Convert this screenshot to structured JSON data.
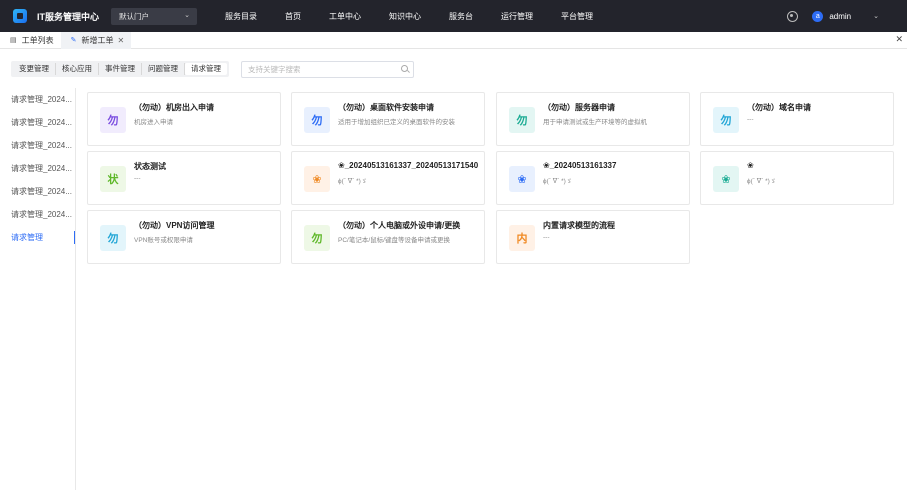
{
  "header": {
    "app_title": "IT服务管理中心",
    "portal": "默认门户",
    "nav": [
      "服务目录",
      "首页",
      "工单中心",
      "知识中心",
      "服务台",
      "运行管理",
      "平台管理"
    ],
    "user": {
      "avatar_letter": "a",
      "name": "admin"
    }
  },
  "tabs": [
    {
      "label": "工单列表"
    },
    {
      "label": "新增工单",
      "close": "✕"
    }
  ],
  "filter": {
    "categories": [
      "变更管理",
      "核心应用",
      "事件管理",
      "问题管理",
      "请求管理"
    ],
    "active": "请求管理",
    "search_placeholder": "支持关键字搜索"
  },
  "sidebar": {
    "items": [
      "请求管理_2024...",
      "请求管理_2024...",
      "请求管理_2024...",
      "请求管理_2024...",
      "请求管理_2024...",
      "请求管理_2024...",
      "请求管理"
    ],
    "active_index": 6
  },
  "cards": [
    {
      "icon": "勿",
      "title": "（勿动）机房出入申请",
      "desc": "机房进入申请",
      "bg": "#f1ecfd",
      "fg": "#7a4ce0"
    },
    {
      "icon": "勿",
      "title": "（勿动）桌面软件安装申请",
      "desc": "适用于增加组织已定义的桌面软件的安装",
      "bg": "#e8f0fe",
      "fg": "#2d6cf5"
    },
    {
      "icon": "勿",
      "title": "（勿动）服务器申请",
      "desc": "用于申请测试或生产环境等的虚拟机",
      "bg": "#e3f6f3",
      "fg": "#1aab93"
    },
    {
      "icon": "勿",
      "title": "（勿动）域名申请",
      "desc": "---",
      "bg": "#e3f5fb",
      "fg": "#22a6d6"
    },
    {
      "icon": "状",
      "title": "状态测试",
      "desc": "---",
      "bg": "#eef8e6",
      "fg": "#5fb82a"
    },
    {
      "icon": "❀",
      "title": "❀_20240513161337_20240513171540",
      "desc": "ɸ(ˊ ᐁˋ *)ゞ",
      "bg": "#fff1e6",
      "fg": "#f08a24"
    },
    {
      "icon": "❀",
      "title": "❀_20240513161337",
      "desc": "ɸ(ˊ ᐁˋ *)ゞ",
      "bg": "#e8f0fe",
      "fg": "#2d6cf5"
    },
    {
      "icon": "❀",
      "title": "❀",
      "desc": "ɸ(ˊ ᐁˋ *)ゞ",
      "bg": "#e3f6f3",
      "fg": "#1aab93"
    },
    {
      "icon": "勿",
      "title": "（勿动）VPN访问管理",
      "desc": "VPN账号或权限申请",
      "bg": "#e3f5fb",
      "fg": "#22a6d6"
    },
    {
      "icon": "勿",
      "title": "（勿动）个人电脑或外设申请/更换",
      "desc": "PC/笔记本/鼠标/键盘等设备申请或更换",
      "bg": "#eef8e6",
      "fg": "#5fb82a"
    },
    {
      "icon": "内",
      "title": "内置请求模型的流程",
      "desc": "---",
      "bg": "#fff1e6",
      "fg": "#f08a24"
    }
  ]
}
